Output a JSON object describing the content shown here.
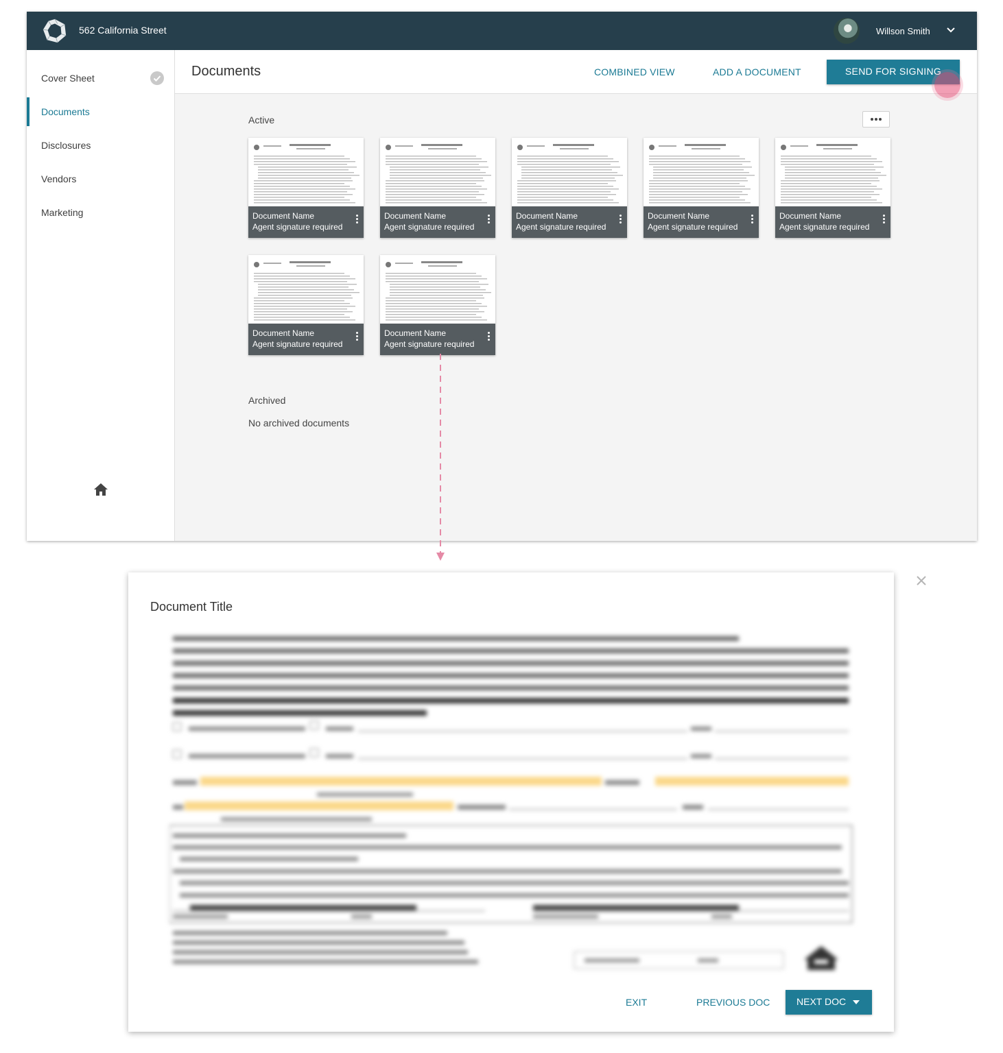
{
  "header": {
    "property_address": "562 California Street",
    "user_name": "Willson Smith"
  },
  "sidebar": {
    "items": [
      {
        "label": "Cover Sheet",
        "completed": true
      },
      {
        "label": "Documents",
        "active": true
      },
      {
        "label": "Disclosures"
      },
      {
        "label": "Vendors"
      },
      {
        "label": "Marketing"
      }
    ]
  },
  "documents_page": {
    "title": "Documents",
    "actions": {
      "combined_view": "COMBINED VIEW",
      "add_document": "ADD A DOCUMENT",
      "send_for_signing": "SEND FOR SIGNING"
    },
    "active_label": "Active",
    "active_documents": [
      {
        "name": "Document Name",
        "status": "Agent signature required"
      },
      {
        "name": "Document Name",
        "status": "Agent signature required"
      },
      {
        "name": "Document Name",
        "status": "Agent signature required"
      },
      {
        "name": "Document Name",
        "status": "Agent signature required"
      },
      {
        "name": "Document Name",
        "status": "Agent signature required"
      },
      {
        "name": "Document Name",
        "status": "Agent signature required"
      },
      {
        "name": "Document Name",
        "status": "Agent signature required"
      }
    ],
    "archived_label": "Archived",
    "archived_empty": "No archived documents"
  },
  "modal": {
    "title": "Document Title",
    "exit": "EXIT",
    "previous": "PREVIOUS DOC",
    "next": "NEXT DOC"
  },
  "colors": {
    "topbar": "#263f4c",
    "accent": "#1b7a94",
    "button": "#1f7c96",
    "caption": "#555c60",
    "highlight_field": "#fbd88a",
    "touch_indicator": "#e85078"
  },
  "icons": [
    "logo-icon",
    "avatar",
    "chevron-down-icon",
    "check-circle-icon",
    "home-icon",
    "more-horizontal-icon",
    "more-vertical-icon",
    "close-icon",
    "caret-down-icon"
  ]
}
